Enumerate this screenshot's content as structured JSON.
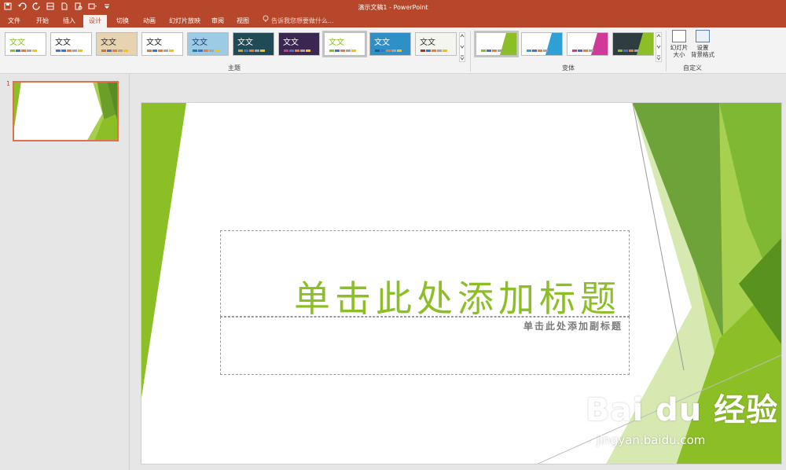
{
  "window": {
    "title": "演示文稿1 - PowerPoint"
  },
  "quick_access": [
    "save-icon",
    "undo-icon",
    "redo-icon",
    "touch-mode-icon",
    "new-icon",
    "print-preview-icon",
    "more-icon",
    "customize-icon"
  ],
  "tabs": [
    {
      "label": "文件"
    },
    {
      "label": "开始"
    },
    {
      "label": "插入"
    },
    {
      "label": "设计",
      "active": true
    },
    {
      "label": "切换"
    },
    {
      "label": "动画"
    },
    {
      "label": "幻灯片放映"
    },
    {
      "label": "审阅"
    },
    {
      "label": "视图"
    }
  ],
  "tell_me": {
    "placeholder": "告诉我您想要做什么..."
  },
  "ribbon": {
    "themes_label": "主题",
    "variants_label": "变体",
    "customize_label": "自定义",
    "slide_size_line1": "幻灯片",
    "slide_size_line2": "大小",
    "format_bg_line1": "设置",
    "format_bg_line2": "背景格式",
    "theme_thumbs": [
      {
        "text": "文文",
        "bg": "#ffffff",
        "fg": "#8cbf26",
        "accent": "#8cbf26"
      },
      {
        "text": "文文",
        "bg": "#ffffff",
        "fg": "#222222",
        "accent": "#4472c4"
      },
      {
        "text": "文文",
        "bg": "#e8d3b0",
        "fg": "#333333",
        "accent": "#c8763a"
      },
      {
        "text": "文文",
        "bg": "#ffffff",
        "fg": "#222222",
        "accent": "#d87a3a"
      },
      {
        "text": "文文",
        "bg": "#9ccbe6",
        "fg": "#1e3c6e",
        "accent": "#2a74b6"
      },
      {
        "text": "文文",
        "bg": "#1f4a56",
        "fg": "#ffffff",
        "accent": "#e0a020"
      },
      {
        "text": "文文",
        "bg": "#3a2650",
        "fg": "#ffffff",
        "accent": "#c04080"
      },
      {
        "text": "文文",
        "bg": "#ffffff",
        "fg": "#8cbf26",
        "accent": "#8cbf26",
        "selected": true
      },
      {
        "text": "文文",
        "bg": "#2f8fc7",
        "fg": "#ffffff",
        "accent": "#1a5f8c"
      },
      {
        "text": "文文",
        "bg": "#f5f5f0",
        "fg": "#333333",
        "accent": "#b03020"
      }
    ],
    "variant_thumbs": [
      {
        "bg": "#ffffff",
        "accent": "#8cbf26"
      },
      {
        "bg": "#ffffff",
        "accent": "#2f9fd8"
      },
      {
        "bg": "#ffffff",
        "accent": "#d0399a"
      },
      {
        "bg": "#2f3c40",
        "accent": "#8cbf26"
      }
    ]
  },
  "slides_pane": {
    "slide_number": "1"
  },
  "slide": {
    "title_placeholder": "单击此处添加标题",
    "subtitle_placeholder": "单击此处添加副标题"
  },
  "watermark": {
    "logo": "Bai du 经验",
    "url": "jingyan.baidu.com"
  },
  "colors": {
    "accent": "#b7472a",
    "green": "#8cbf26"
  }
}
